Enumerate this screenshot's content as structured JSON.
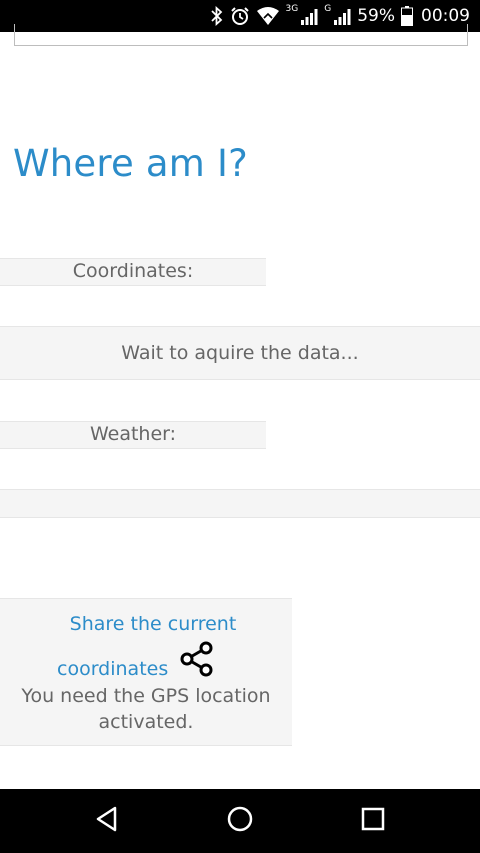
{
  "status_bar": {
    "network_3g": "3G",
    "network_g": "G",
    "battery_percent": "59%",
    "time": "00:09",
    "icons": [
      "bluetooth-icon",
      "alarm-icon",
      "wifi-icon",
      "signal-icon",
      "battery-icon"
    ]
  },
  "page": {
    "title": "Where am I?"
  },
  "coordinates": {
    "label": "Coordinates:",
    "value": "Wait to aquire the data..."
  },
  "weather": {
    "label": "Weather:",
    "value": ""
  },
  "share": {
    "link_line1": "Share the current",
    "link_line2": "coordinates",
    "icon": "share-icon",
    "note": "You need the GPS location activated."
  },
  "nav_bar": {
    "icons": [
      "back-icon",
      "home-icon",
      "recents-icon"
    ]
  },
  "colors": {
    "accent": "#2c8cc9",
    "text_muted": "#666666",
    "strip_background": "#f5f5f5",
    "bar_background": "#000000"
  }
}
